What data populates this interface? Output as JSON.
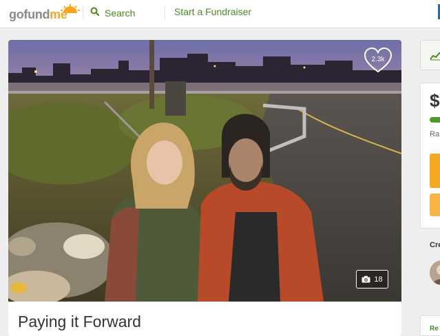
{
  "header": {
    "logo": {
      "go": "go",
      "fund": "fund",
      "me": "me"
    },
    "search_label": "Search",
    "start_fundraiser_label": "Start a Fundraiser"
  },
  "campaign": {
    "heart_count": "2.3k",
    "photo_count": "18",
    "title": "Paying it Forward"
  },
  "sidebar": {
    "amount_prefix": "$",
    "raised_prefix": "Ra",
    "progress_fraction": 0.42,
    "created_label": "Cre",
    "bottom_card_label": "Re"
  },
  "colors": {
    "brand_green": "#4a8a20",
    "brand_orange": "#f7a823",
    "progress_green": "#4e9a27"
  },
  "icons": {
    "search": "search-icon",
    "heart": "heart-icon",
    "camera": "camera-icon",
    "chart": "chart-icon",
    "sun": "logo-sun-icon"
  }
}
